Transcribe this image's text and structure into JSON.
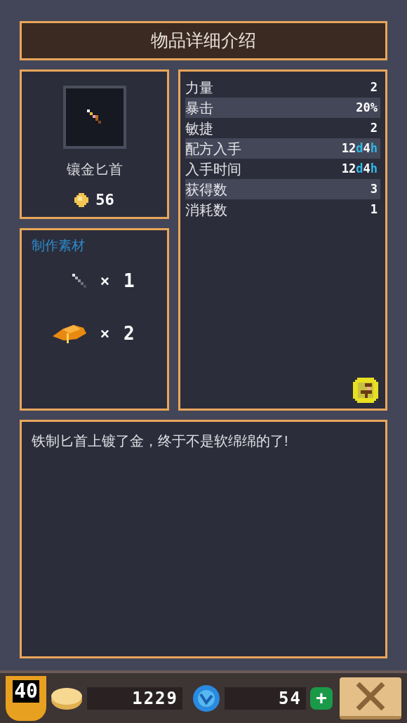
{
  "title": "物品详细介绍",
  "item": {
    "name": "镶金匕首",
    "price": "56"
  },
  "stats": [
    {
      "label": "力量",
      "value": [
        {
          "text": "2",
          "kind": "number"
        }
      ]
    },
    {
      "label": "暴击",
      "value": [
        {
          "text": "20%",
          "kind": "number"
        }
      ]
    },
    {
      "label": "敏捷",
      "value": [
        {
          "text": "2",
          "kind": "number"
        }
      ]
    },
    {
      "label": "配方入手",
      "value": [
        {
          "text": "12",
          "kind": "number"
        },
        {
          "text": "d",
          "kind": "unit"
        },
        {
          "text": "4",
          "kind": "number"
        },
        {
          "text": "h",
          "kind": "unit"
        }
      ]
    },
    {
      "label": "入手时间",
      "value": [
        {
          "text": "12",
          "kind": "number"
        },
        {
          "text": "d",
          "kind": "unit"
        },
        {
          "text": "4",
          "kind": "number"
        },
        {
          "text": "h",
          "kind": "unit"
        }
      ]
    },
    {
      "label": "获得数",
      "value": [
        {
          "text": "3",
          "kind": "number"
        }
      ]
    },
    {
      "label": "消耗数",
      "value": [
        {
          "text": "1",
          "kind": "number"
        }
      ]
    }
  ],
  "materials": {
    "title": "制作素材",
    "items": [
      {
        "kind": "dagger",
        "times": "×",
        "count": "1"
      },
      {
        "kind": "ingot",
        "times": "×",
        "count": "2"
      }
    ]
  },
  "description": "铁制匕首上镀了金，终于不是软绵绵的了!",
  "bottom_bar": {
    "level": "40",
    "gold": "1229",
    "gems": "54",
    "add": "+"
  }
}
